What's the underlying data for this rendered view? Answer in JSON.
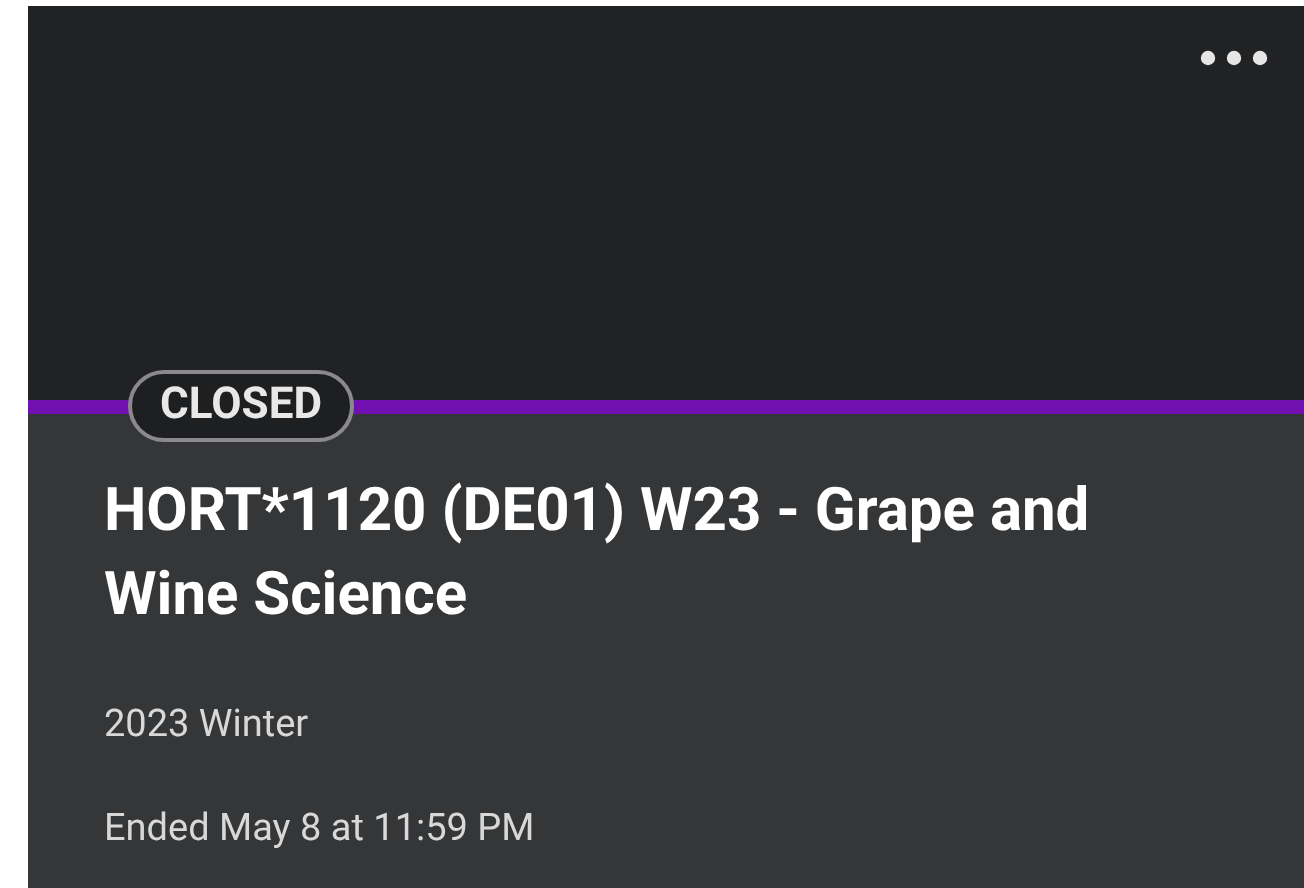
{
  "course_card": {
    "badge": "CLOSED",
    "title": "HORT*1120 (DE01) W23 - Grape and Wine Science",
    "term": "2023 Winter",
    "end_date": "Ended May 8 at 11:59 PM"
  }
}
